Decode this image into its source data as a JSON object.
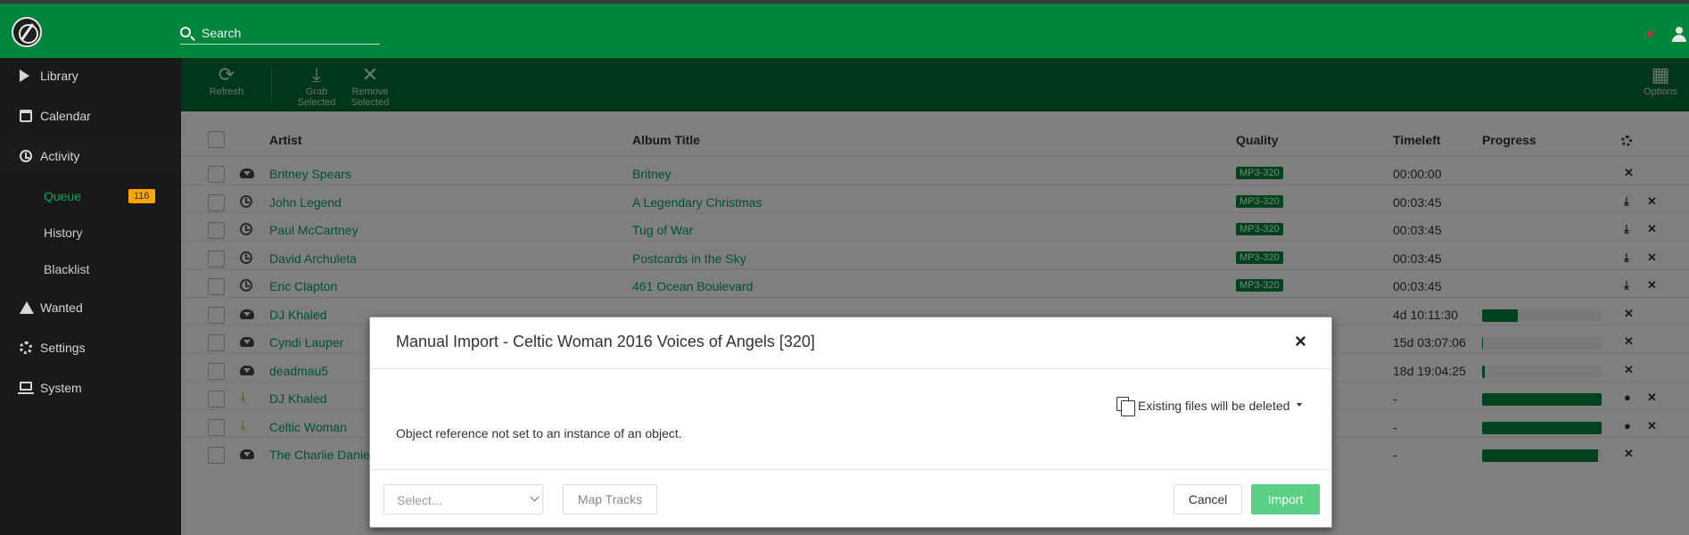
{
  "header": {
    "search_placeholder": "Search",
    "logo_icon": "lidarr-logo-icon",
    "brand_color": "#00853d"
  },
  "sidebar": {
    "items": [
      {
        "label": "Library",
        "icon": "play-icon"
      },
      {
        "label": "Calendar",
        "icon": "calendar-icon"
      },
      {
        "label": "Activity",
        "icon": "clock-icon"
      },
      {
        "label": "Wanted",
        "icon": "warning-icon"
      },
      {
        "label": "Settings",
        "icon": "gear-icon"
      },
      {
        "label": "System",
        "icon": "laptop-icon"
      }
    ],
    "activity_sub": [
      {
        "label": "Queue",
        "badge": "116"
      },
      {
        "label": "History"
      },
      {
        "label": "Blacklist"
      }
    ]
  },
  "toolbar": {
    "refresh": "Refresh",
    "grab_selected": "Grab Selected",
    "remove_selected": "Remove Selected",
    "options": "Options"
  },
  "table": {
    "columns": [
      "Artist",
      "Album Title",
      "Quality",
      "Timeleft",
      "Progress"
    ],
    "rows": [
      {
        "status": "cloud",
        "artist": "Britney Spears",
        "album": "Britney",
        "quality": "MP3-320",
        "timeleft": "00:00:00",
        "progress": null,
        "actions": [
          "remove"
        ]
      },
      {
        "status": "clock",
        "artist": "John Legend",
        "album": "A Legendary Christmas",
        "quality": "MP3-320",
        "timeleft": "00:03:45",
        "progress": null,
        "actions": [
          "download",
          "remove"
        ]
      },
      {
        "status": "clock",
        "artist": "Paul McCartney",
        "album": "Tug of War",
        "quality": "MP3-320",
        "timeleft": "00:03:45",
        "progress": null,
        "actions": [
          "download",
          "remove"
        ]
      },
      {
        "status": "clock",
        "artist": "David Archuleta",
        "album": "Postcards in the Sky",
        "quality": "MP3-320",
        "timeleft": "00:03:45",
        "progress": null,
        "actions": [
          "download",
          "remove"
        ]
      },
      {
        "status": "clock",
        "artist": "Eric Clapton",
        "album": "461 Ocean Boulevard",
        "quality": "MP3-320",
        "timeleft": "00:03:45",
        "progress": null,
        "actions": [
          "download",
          "remove"
        ]
      },
      {
        "status": "cloud",
        "artist": "DJ Khaled",
        "album": "",
        "quality": "",
        "timeleft": "4d 10:11:30",
        "progress": 0.3,
        "actions": [
          "remove"
        ]
      },
      {
        "status": "cloud",
        "artist": "Cyndi Lauper",
        "album": "",
        "quality": "",
        "timeleft": "15d 03:07:06",
        "progress": 0.01,
        "actions": [
          "remove"
        ]
      },
      {
        "status": "cloud",
        "artist": "deadmau5",
        "album": "",
        "quality": "",
        "timeleft": "18d 19:04:25",
        "progress": 0.02,
        "actions": [
          "remove"
        ]
      },
      {
        "status": "download",
        "artist": "DJ Khaled",
        "album": "",
        "quality": "",
        "timeleft": "-",
        "progress": 1.0,
        "actions": [
          "import",
          "remove"
        ]
      },
      {
        "status": "download",
        "artist": "Celtic Woman",
        "album": "",
        "quality": "",
        "timeleft": "-",
        "progress": 1.0,
        "actions": [
          "import",
          "remove"
        ]
      },
      {
        "status": "cloud",
        "artist": "The Charlie Daniel",
        "album": "",
        "quality": "",
        "timeleft": "-",
        "progress": 0.97,
        "actions": [
          "remove"
        ]
      }
    ]
  },
  "modal": {
    "title": "Manual Import - Celtic Woman 2016 Voices of Angels [320]",
    "import_mode": "Existing files will be deleted",
    "message": "Object reference not set to an instance of an object.",
    "select_placeholder": "Select...",
    "map_tracks": "Map Tracks",
    "cancel": "Cancel",
    "import": "Import",
    "import_color": "#5ad087"
  }
}
